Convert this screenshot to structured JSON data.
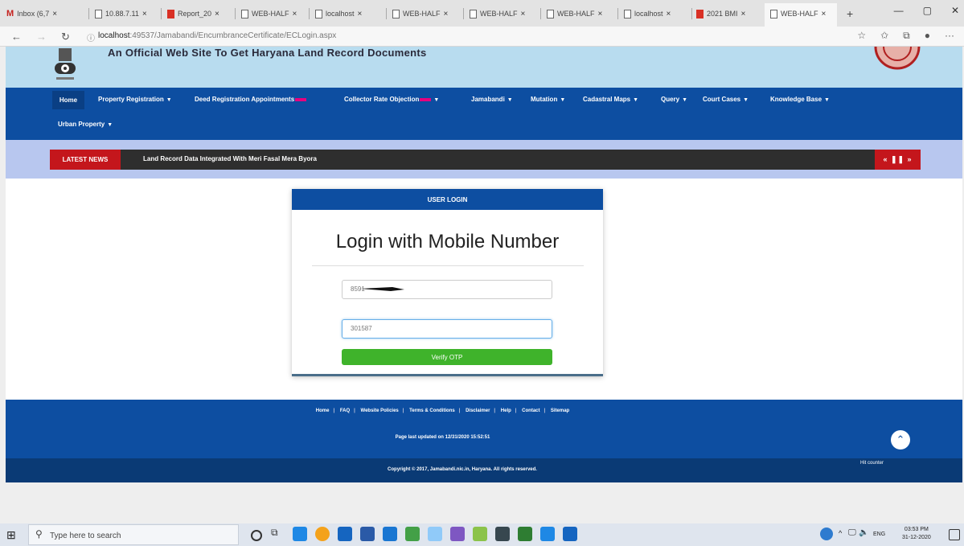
{
  "browser": {
    "tabs": [
      {
        "label": "Inbox (6,7",
        "icon": "mail-icon"
      },
      {
        "label": "10.88.7.11",
        "icon": "page-icon"
      },
      {
        "label": "Report_20",
        "icon": "pdf-icon"
      },
      {
        "label": "WEB-HALF",
        "icon": "page-icon"
      },
      {
        "label": "localhost",
        "icon": "page-icon"
      },
      {
        "label": "WEB-HALF",
        "icon": "page-icon"
      },
      {
        "label": "WEB-HALF",
        "icon": "page-icon"
      },
      {
        "label": "WEB-HALF",
        "icon": "page-icon"
      },
      {
        "label": "localhost",
        "icon": "page-icon"
      },
      {
        "label": "2021 BMI",
        "icon": "pdf-icon"
      },
      {
        "label": "WEB-HALF",
        "icon": "page-icon",
        "active": true
      }
    ],
    "url_host": "localhost",
    "url_rest": ":49537/Jamabandi/EncumbranceCertificate/ECLogin.aspx"
  },
  "site": {
    "title": "An Official Web Site To Get Haryana Land Record Documents"
  },
  "nav": {
    "items": [
      {
        "label": "Home",
        "caret": false
      },
      {
        "label": "Property Registration",
        "caret": true
      },
      {
        "label": "Deed Registration Appointments",
        "caret": false,
        "badge": true
      },
      {
        "label": "Collector Rate Objection",
        "caret": true,
        "badge": true
      },
      {
        "label": "Jamabandi",
        "caret": true
      },
      {
        "label": "Mutation",
        "caret": true
      },
      {
        "label": "Cadastral Maps",
        "caret": true
      },
      {
        "label": "Query",
        "caret": true
      },
      {
        "label": "Court Cases",
        "caret": true
      },
      {
        "label": "Knowledge Base",
        "caret": true
      },
      {
        "label": "Urban Property",
        "caret": true
      }
    ]
  },
  "news": {
    "label": "LATEST NEWS",
    "text": "Land Record Data Integrated With Meri Fasal Mera Byora",
    "controls": "« ❚❚ »"
  },
  "login": {
    "header": "USER LOGIN",
    "title": "Login with Mobile Number",
    "mobile_value": "8591",
    "otp_value": "301587",
    "verify_label": "Verify OTP"
  },
  "footer": {
    "links": [
      "Home",
      "FAQ",
      "Website Policies",
      "Terms & Conditions",
      "Disclaimer",
      "Help",
      "Contact",
      "Sitemap"
    ],
    "updated": "Page last updated on 12/31/2020 15:52:51",
    "copyright": "Copyright © 2017, Jamabandi.nic.in, Haryana. All rights reserved.",
    "hit_counter": "Hit counter"
  },
  "taskbar": {
    "search_placeholder": "Type here to search",
    "tray_lang": "ENG",
    "time": "03:53 PM",
    "date": "31-12-2020"
  },
  "colors": {
    "nav_blue": "#0d4ea1",
    "header_light_blue": "#b8dcef",
    "news_red": "#c4161c",
    "verify_green": "#3fb32b"
  }
}
